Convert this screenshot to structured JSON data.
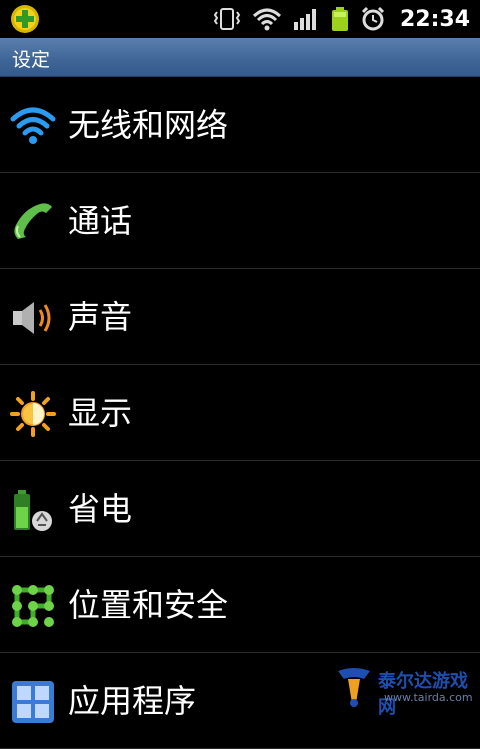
{
  "status_bar": {
    "time": "22:34",
    "icons": [
      "add-app-icon",
      "vibrate-icon",
      "wifi-icon",
      "signal-icon",
      "battery-icon",
      "alarm-icon"
    ]
  },
  "title_bar": {
    "title": "设定"
  },
  "settings": {
    "items": [
      {
        "label": "无线和网络",
        "icon": "wifi-icon"
      },
      {
        "label": "通话",
        "icon": "phone-icon"
      },
      {
        "label": "声音",
        "icon": "speaker-icon"
      },
      {
        "label": "显示",
        "icon": "brightness-icon"
      },
      {
        "label": "省电",
        "icon": "battery-recycle-icon"
      },
      {
        "label": "位置和安全",
        "icon": "lock-pattern-icon"
      },
      {
        "label": "应用程序",
        "icon": "applications-icon"
      }
    ]
  },
  "watermark": {
    "text": "泰尔达游戏网",
    "url": "www.tairda.com"
  },
  "colors": {
    "title_bar": "#3e6596",
    "background": "#000000",
    "divider": "#2a2a2a"
  }
}
